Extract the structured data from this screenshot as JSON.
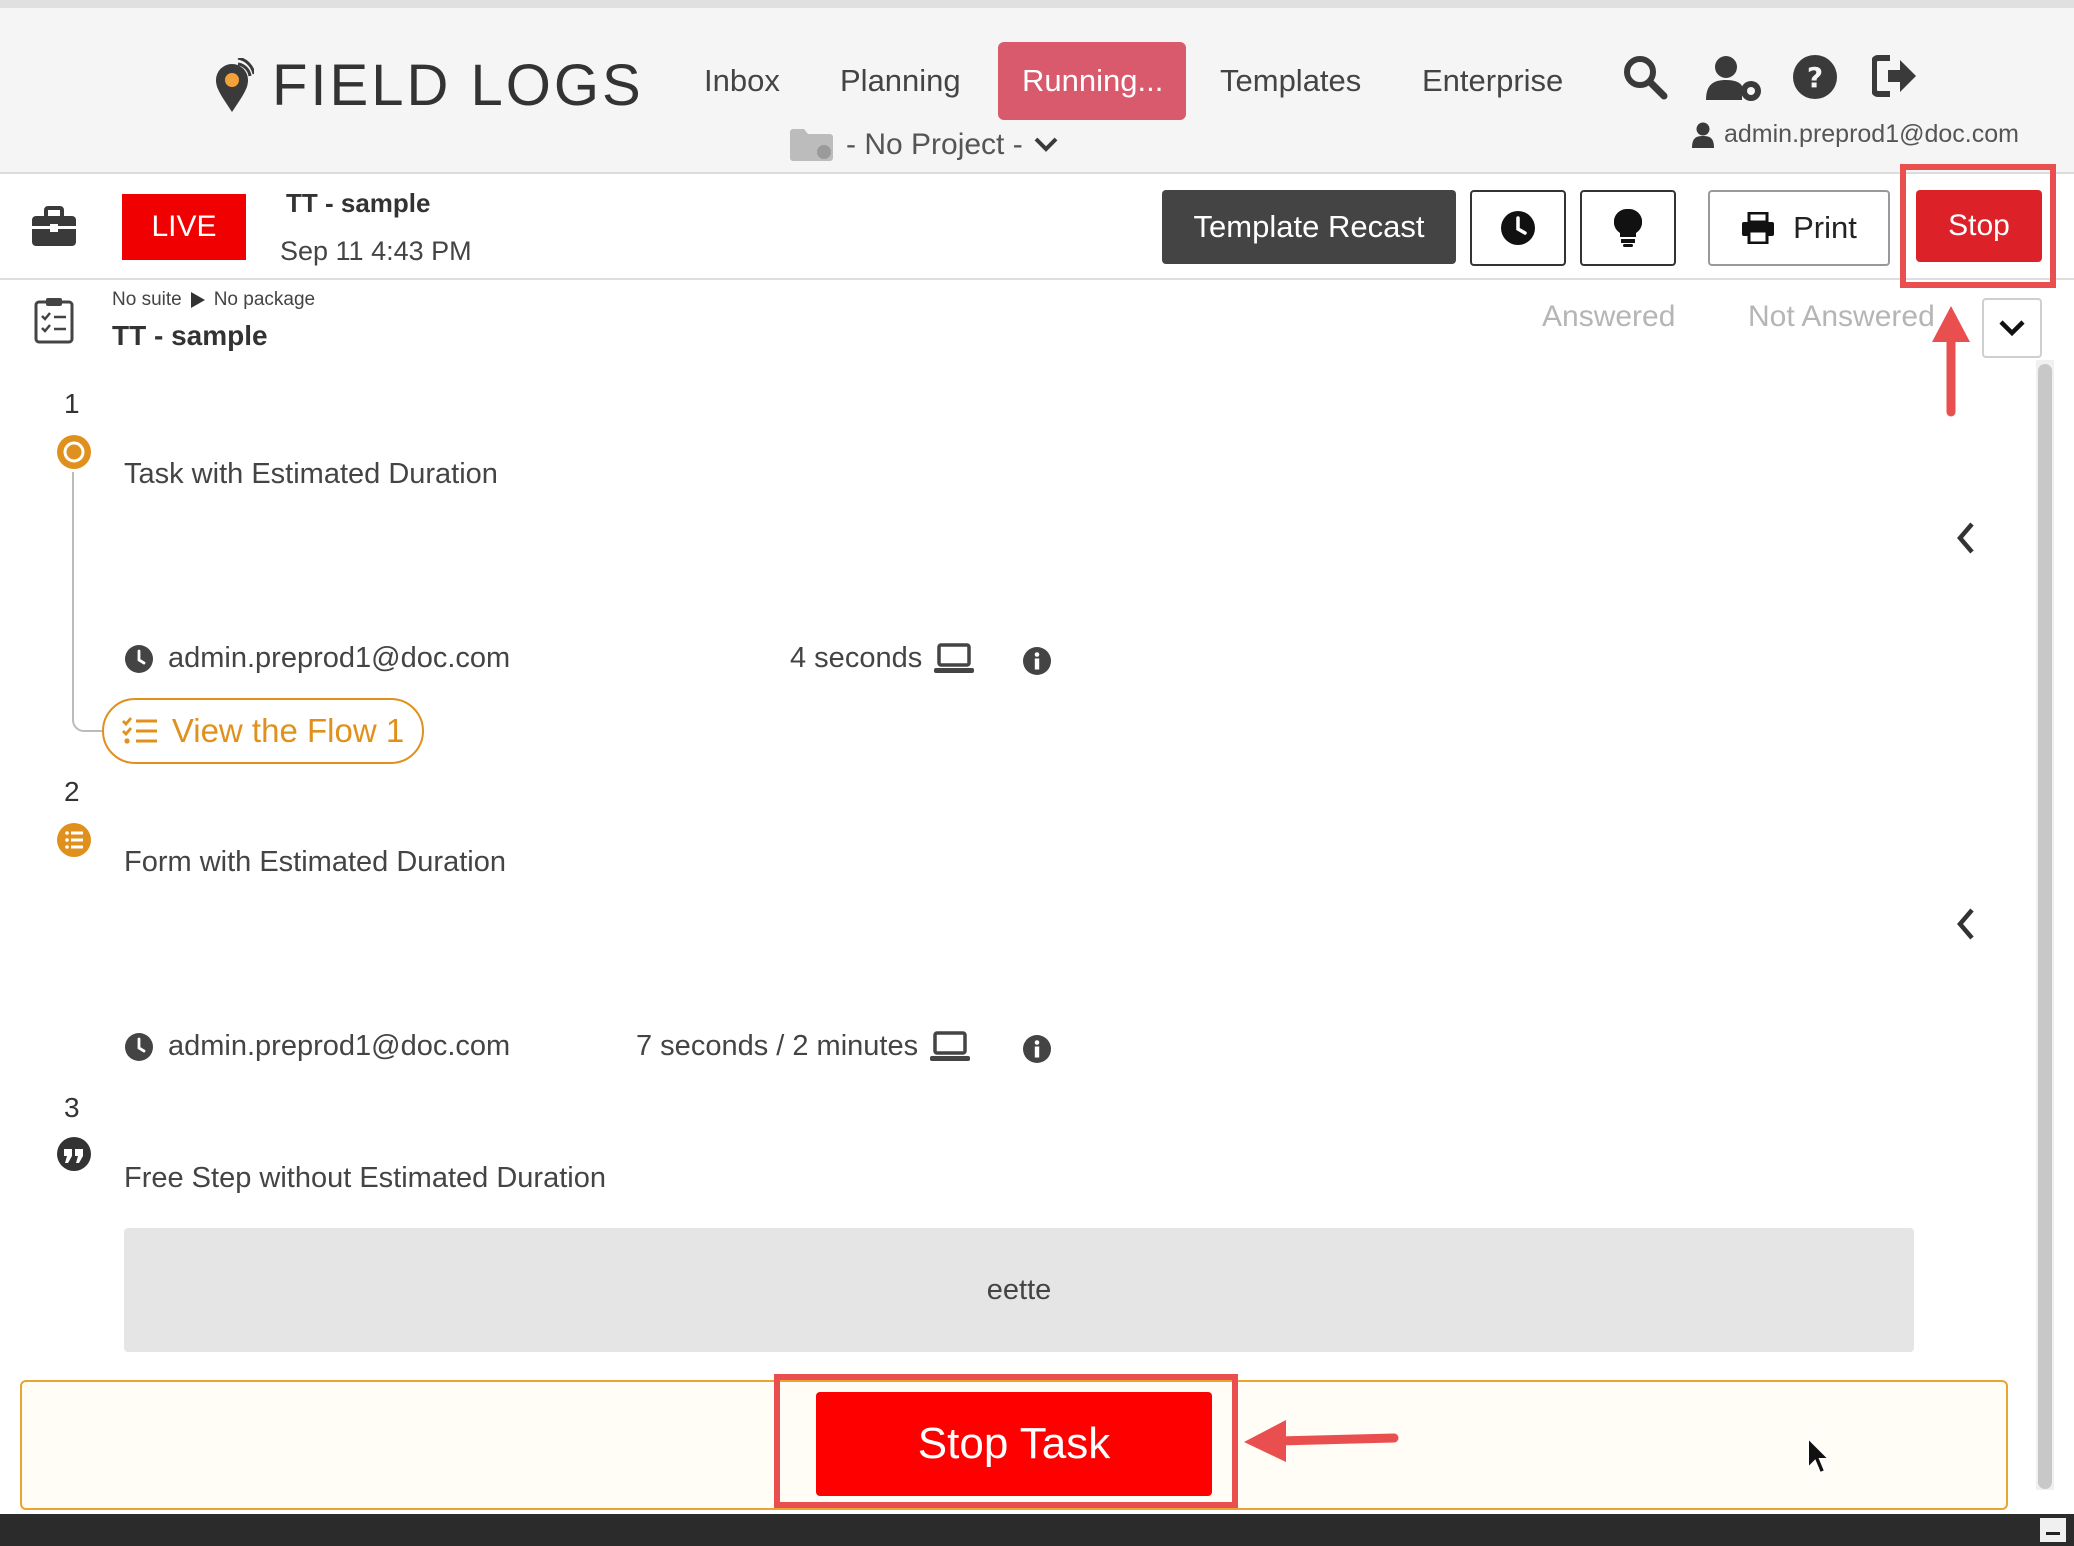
{
  "header": {
    "logo_text": "FIELD LOGS",
    "nav": [
      {
        "label": "Inbox",
        "active": false
      },
      {
        "label": "Planning",
        "active": false
      },
      {
        "label": "Running...",
        "active": true
      },
      {
        "label": "Templates",
        "active": false
      },
      {
        "label": "Enterprise",
        "active": false
      }
    ],
    "icons": [
      "search-icon",
      "user-settings-icon",
      "help-icon",
      "logout-icon"
    ],
    "project_label": "- No Project -",
    "user_email": "admin.preprod1@doc.com"
  },
  "run_bar": {
    "live_label": "LIVE",
    "title": "TT - sample",
    "timestamp": "Sep 11 4:43 PM",
    "template_recast_label": "Template Recast",
    "print_label": "Print",
    "stop_label": "Stop"
  },
  "task": {
    "suite": "No suite",
    "package": "No package",
    "title": "TT - sample",
    "filters": [
      "Answered",
      "Not Answered"
    ],
    "steps": [
      {
        "number": "1",
        "label": "Task with Estimated Duration",
        "user": "admin.preprod1@doc.com",
        "duration": "4 seconds",
        "flow_button": "View the Flow 1"
      },
      {
        "number": "2",
        "label": "Form with Estimated Duration",
        "user": "admin.preprod1@doc.com",
        "duration": "7 seconds / 2 minutes"
      },
      {
        "number": "3",
        "label": "Free Step without Estimated Duration",
        "answer": "eette"
      }
    ],
    "stop_task_label": "Stop Task"
  },
  "colors": {
    "accent_running": "#d9596d",
    "live_red": "#f00000",
    "stop_red": "#dc2228",
    "step_orange": "#e0911d",
    "annotation_red": "#ea4f4f"
  }
}
